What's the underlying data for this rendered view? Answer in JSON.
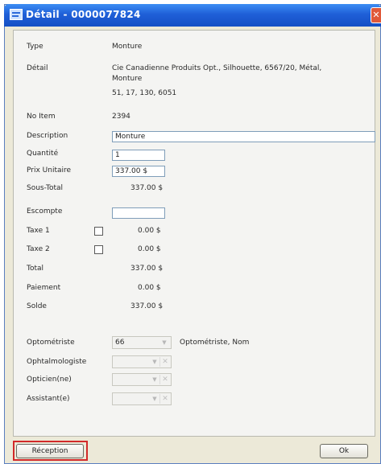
{
  "window": {
    "title": "Détail - 0000077824",
    "close_glyph": "✕"
  },
  "fields": {
    "type_label": "Type",
    "type_value": "Monture",
    "detail_label": "Détail",
    "detail_line1": "Cie Canadienne Produits Opt., Silhouette, 6567/20, Métal,",
    "detail_line2": "Monture",
    "detail_line3": "51, 17, 130, 6051",
    "no_item_label": "No Item",
    "no_item_value": "2394",
    "description_label": "Description",
    "description_value": "Monture",
    "quantite_label": "Quantité",
    "quantite_value": "1",
    "prix_label": "Prix Unitaire",
    "prix_value": "337.00 $",
    "sous_total_label": "Sous-Total",
    "sous_total_value": "337.00 $",
    "escompte_label": "Escompte",
    "escompte_value": "",
    "taxe1_label": "Taxe 1",
    "taxe1_value": "0.00 $",
    "taxe2_label": "Taxe 2",
    "taxe2_value": "0.00 $",
    "total_label": "Total",
    "total_value": "337.00 $",
    "paiement_label": "Paiement",
    "paiement_value": "0.00 $",
    "solde_label": "Solde",
    "solde_value": "337.00 $"
  },
  "professionals": {
    "optometriste_label": "Optométriste",
    "optometriste_value": "66",
    "optometriste_name": "Optométriste, Nom",
    "ophtalmologiste_label": "Ophtalmologiste",
    "ophtalmologiste_value": "",
    "opticien_label": "Opticien(ne)",
    "opticien_value": "",
    "assistant_label": "Assistant(e)",
    "assistant_value": ""
  },
  "buttons": {
    "reception_label": "Réception",
    "ok_label": "Ok"
  },
  "icons": {
    "dropdown": "▼",
    "clear": "✕"
  },
  "colors": {
    "titlebar": "#1f5fd8",
    "highlight": "#d22a2a",
    "close": "#e0593a"
  }
}
